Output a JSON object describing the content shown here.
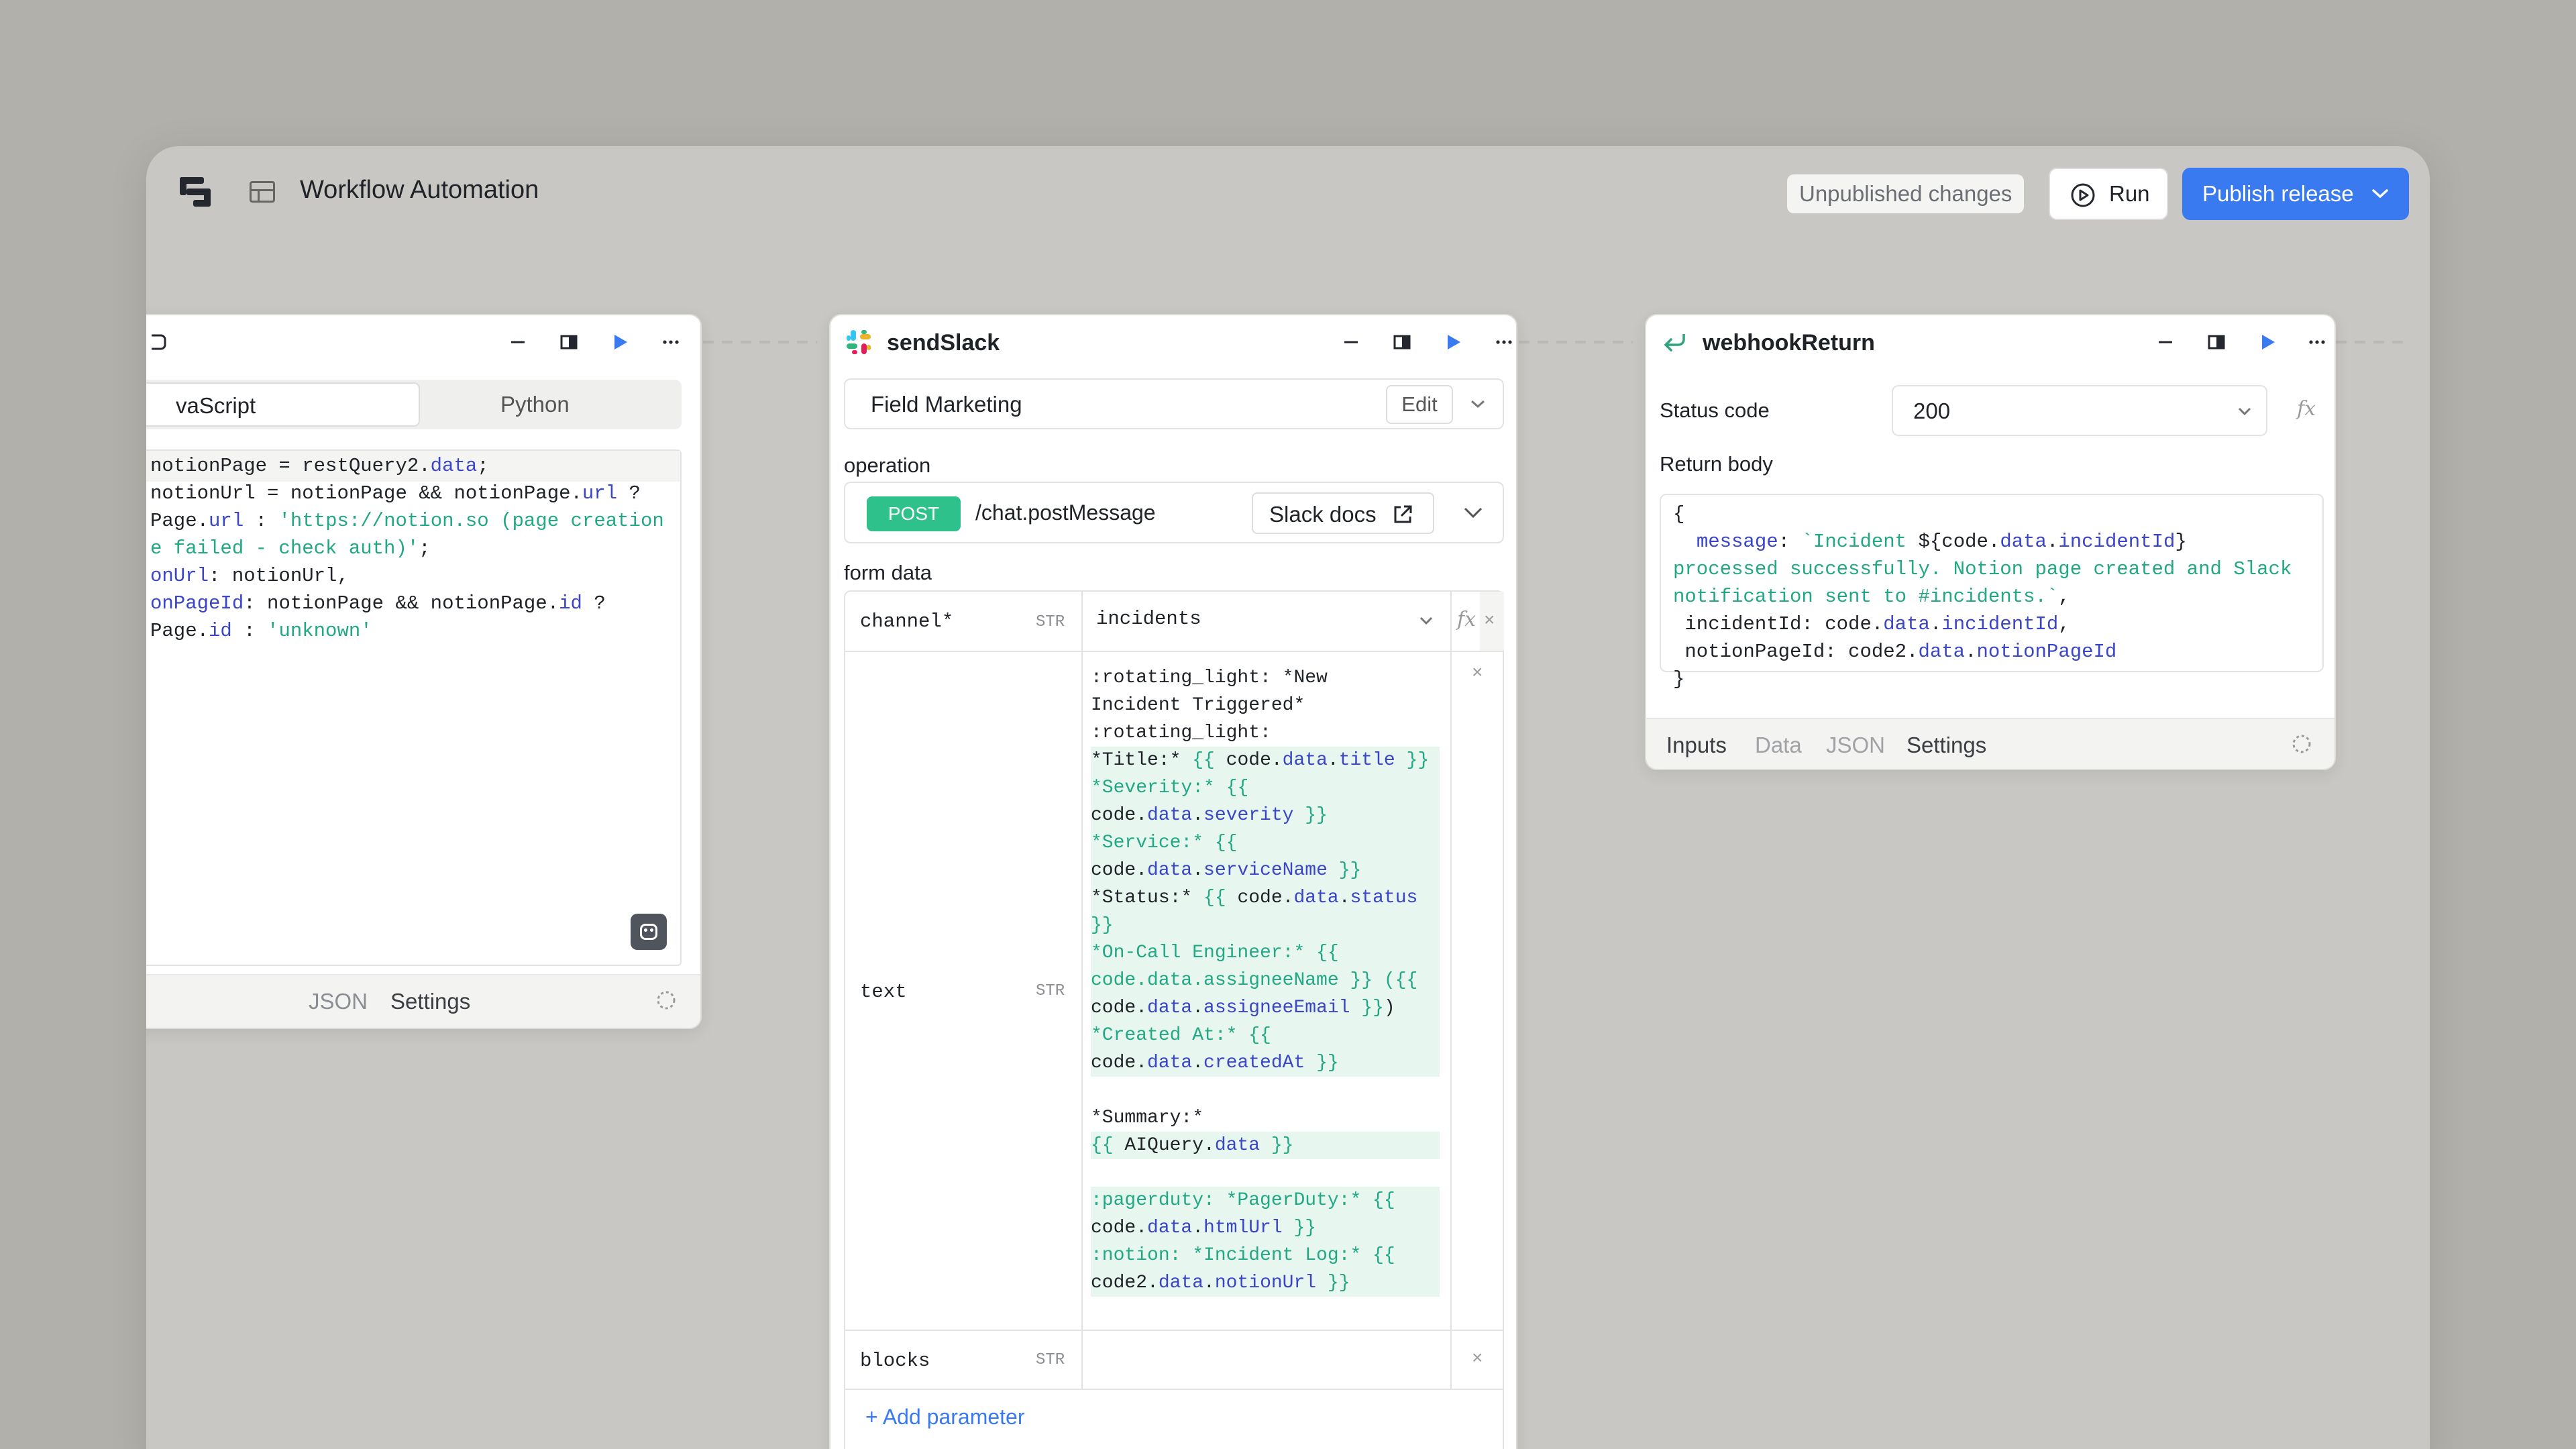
{
  "header": {
    "app_title": "Workflow Automation",
    "unpublished_label": "Unpublished changes",
    "run_label": "Run",
    "publish_label": "Publish release"
  },
  "code_panel": {
    "tabs": [
      "vaScript",
      "Python"
    ],
    "code_lines": [
      [
        {
          "t": "notionPage = restQuery2."
        },
        {
          "t": "data",
          "c": "k"
        },
        {
          "t": ";"
        }
      ],
      [
        {
          "t": "notionUrl = notionPage && notionPage."
        },
        {
          "t": "url",
          "c": "k"
        },
        {
          "t": " ?"
        }
      ],
      [
        {
          "t": "Page."
        },
        {
          "t": "url",
          "c": "k"
        },
        {
          "t": " : "
        },
        {
          "t": "'https://notion.so (page creation",
          "c": "s"
        }
      ],
      [
        {
          "t": "e failed - check auth)'",
          "c": "s"
        },
        {
          "t": ";"
        }
      ],
      [
        {
          "t": "onUrl",
          "c": "k"
        },
        {
          "t": ": notionUrl,"
        }
      ],
      [
        {
          "t": "onPageId",
          "c": "k"
        },
        {
          "t": ": notionPage && notionPage."
        },
        {
          "t": "id",
          "c": "k"
        },
        {
          "t": " ?"
        }
      ],
      [
        {
          "t": "Page."
        },
        {
          "t": "id",
          "c": "k"
        },
        {
          "t": " : "
        },
        {
          "t": "'unknown'",
          "c": "s"
        }
      ]
    ],
    "footer_tabs": [
      "JSON",
      "Settings"
    ]
  },
  "slack_panel": {
    "title": "sendSlack",
    "resource": "Field Marketing",
    "edit_label": "Edit",
    "operation_label": "operation",
    "method": "POST",
    "endpoint": "/chat.postMessage",
    "docs_label": "Slack docs",
    "form_data_label": "form data",
    "channel": {
      "key": "channel*",
      "type": "STR",
      "value": "incidents"
    },
    "text": {
      "key": "text",
      "type": "STR",
      "lines": [
        [
          {
            "t": ":rotating_light: *New"
          }
        ],
        [
          {
            "t": "Incident Triggered*"
          }
        ],
        [
          {
            "t": ":rotating_light:"
          }
        ],
        [
          {
            "t": "*Title:* "
          },
          {
            "t": "{{ ",
            "c": "g"
          },
          {
            "t": "code."
          },
          {
            "t": "data",
            "c": "k"
          },
          {
            "t": "."
          },
          {
            "t": "title",
            "c": "k"
          },
          {
            "t": " }}",
            "c": "g"
          }
        ],
        [
          {
            "t": "*Severity:* ",
            "c": "g"
          },
          {
            "t": "{{",
            "c": "g"
          }
        ],
        [
          {
            "t": "code."
          },
          {
            "t": "data",
            "c": "k"
          },
          {
            "t": "."
          },
          {
            "t": "severity",
            "c": "k"
          },
          {
            "t": " }}",
            "c": "g"
          }
        ],
        [
          {
            "t": "*Service:* ",
            "c": "g"
          },
          {
            "t": "{{",
            "c": "g"
          }
        ],
        [
          {
            "t": "code."
          },
          {
            "t": "data",
            "c": "k"
          },
          {
            "t": "."
          },
          {
            "t": "serviceName",
            "c": "k"
          },
          {
            "t": " }}",
            "c": "g"
          }
        ],
        [
          {
            "t": "*Status:* "
          },
          {
            "t": "{{ ",
            "c": "g"
          },
          {
            "t": "code."
          },
          {
            "t": "data",
            "c": "k"
          },
          {
            "t": "."
          },
          {
            "t": "status",
            "c": "k"
          }
        ],
        [
          {
            "t": "}}",
            "c": "g"
          }
        ],
        [
          {
            "t": "*On-Call Engineer:* ",
            "c": "g"
          },
          {
            "t": "{{",
            "c": "g"
          }
        ],
        [
          {
            "t": "code.data.assigneeName",
            "c": "g"
          },
          {
            "t": " }} (",
            "c": "g"
          },
          {
            "t": "{{",
            "c": "g"
          }
        ],
        [
          {
            "t": "code."
          },
          {
            "t": "data",
            "c": "k"
          },
          {
            "t": "."
          },
          {
            "t": "assigneeEmail",
            "c": "k"
          },
          {
            "t": " }}",
            "c": "g"
          },
          {
            "t": ")"
          }
        ],
        [
          {
            "t": "*Created At:* ",
            "c": "g"
          },
          {
            "t": "{{",
            "c": "g"
          }
        ],
        [
          {
            "t": "code."
          },
          {
            "t": "data",
            "c": "k"
          },
          {
            "t": "."
          },
          {
            "t": "createdAt",
            "c": "k"
          },
          {
            "t": " }}",
            "c": "g"
          }
        ],
        [
          {
            "t": ""
          }
        ],
        [
          {
            "t": "*Summary:*"
          }
        ],
        [
          {
            "t": "{{ ",
            "c": "g"
          },
          {
            "t": "AIQuery."
          },
          {
            "t": "data",
            "c": "k"
          },
          {
            "t": " }}",
            "c": "g"
          }
        ],
        [
          {
            "t": ""
          }
        ],
        [
          {
            "t": ":pagerduty: *PagerDuty:* ",
            "c": "g"
          },
          {
            "t": "{{",
            "c": "g"
          }
        ],
        [
          {
            "t": "code."
          },
          {
            "t": "data",
            "c": "k"
          },
          {
            "t": "."
          },
          {
            "t": "htmlUrl",
            "c": "k"
          },
          {
            "t": " }}",
            "c": "g"
          }
        ],
        [
          {
            "t": ":notion: *Incident Log:* ",
            "c": "g"
          },
          {
            "t": "{{",
            "c": "g"
          }
        ],
        [
          {
            "t": "code2."
          },
          {
            "t": "data",
            "c": "k"
          },
          {
            "t": "."
          },
          {
            "t": "notionUrl",
            "c": "k"
          },
          {
            "t": " }}",
            "c": "g"
          }
        ]
      ]
    },
    "blocks": {
      "key": "blocks",
      "type": "STR"
    },
    "add_param_label": "+ Add parameter"
  },
  "webhook_panel": {
    "title": "webhookReturn",
    "status_label": "Status code",
    "status_value": "200",
    "return_body_label": "Return body",
    "body_lines": [
      [
        {
          "t": "{"
        }
      ],
      [
        {
          "t": "  "
        },
        {
          "t": "message",
          "c": "k"
        },
        {
          "t": ": "
        },
        {
          "t": "`Incident ",
          "c": "s"
        },
        {
          "t": "${code."
        },
        {
          "t": "data",
          "c": "k"
        },
        {
          "t": "."
        },
        {
          "t": "incidentId",
          "c": "k"
        },
        {
          "t": "}"
        }
      ],
      [
        {
          "t": "processed successfully. Notion page created and Slack",
          "c": "s"
        }
      ],
      [
        {
          "t": "notification sent to #incidents.`",
          "c": "s"
        },
        {
          "t": ","
        }
      ],
      [
        {
          "t": " incidentId: code."
        },
        {
          "t": "data",
          "c": "k"
        },
        {
          "t": "."
        },
        {
          "t": "incidentId",
          "c": "k"
        },
        {
          "t": ","
        }
      ],
      [
        {
          "t": " notionPageId: code2."
        },
        {
          "t": "data",
          "c": "k"
        },
        {
          "t": "."
        },
        {
          "t": "notionPageId",
          "c": "k"
        }
      ],
      [
        {
          "t": "}"
        }
      ]
    ],
    "footer_tabs": [
      "Inputs",
      "Data",
      "JSON",
      "Settings"
    ]
  },
  "colors": {
    "accent": "#3a7af0",
    "post_badge": "#2fc18c",
    "template_green": "#22a884",
    "keyword_blue": "#3b45c8"
  }
}
